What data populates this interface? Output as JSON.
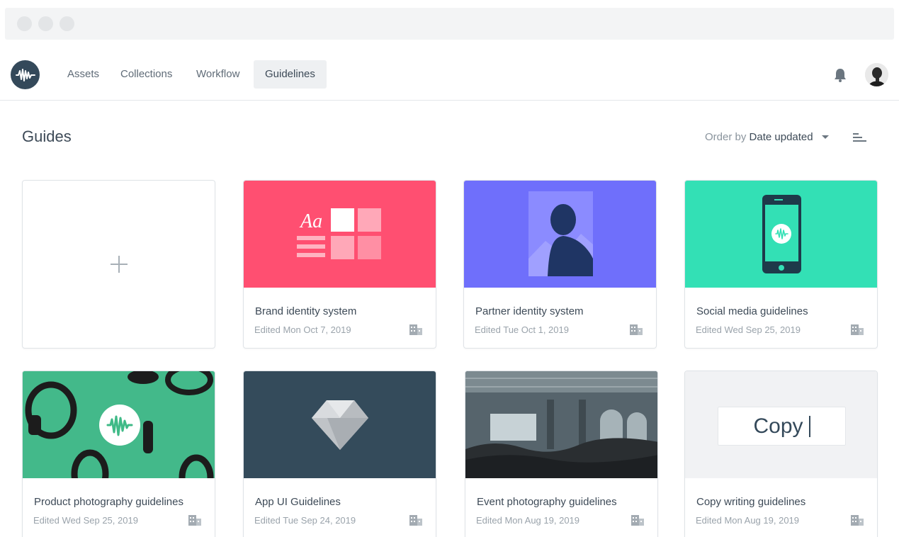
{
  "nav": {
    "items": [
      {
        "label": "Assets",
        "active": false
      },
      {
        "label": "Collections",
        "active": false
      },
      {
        "label": "Workflow",
        "active": false
      },
      {
        "label": "Guidelines",
        "active": true
      }
    ],
    "icons": {
      "logo": "waveform-logo-icon",
      "notifications": "bell-icon",
      "profile": "avatar"
    }
  },
  "page": {
    "title": "Guides",
    "order_prefix": "Order by",
    "order_value": "Date updated"
  },
  "cards": [
    {
      "title": "Brand identity system",
      "date": "Edited Mon Oct 7, 2019",
      "thumb_color": "#ff4f71"
    },
    {
      "title": "Partner identity system",
      "date": "Edited Tue Oct 1, 2019",
      "thumb_color": "#6f6ffb"
    },
    {
      "title": "Social media guidelines",
      "date": "Edited Wed Sep 25, 2019",
      "thumb_color": "#33e0b5"
    },
    {
      "title": "Product photography guidelines",
      "date": "Edited Wed Sep 25, 2019",
      "thumb_color": "#3fba87"
    },
    {
      "title": "App UI Guidelines",
      "date": "Edited Tue Sep 24, 2019",
      "thumb_color": "#344b5b"
    },
    {
      "title": "Event photography guidelines",
      "date": "Edited Mon Aug 19, 2019",
      "thumb_color": "#5c6a72"
    },
    {
      "title": "Copy writing guidelines",
      "date": "Edited Mon Aug 19, 2019",
      "thumb_color": "#f1f2f4",
      "thumb_text": "Copy"
    }
  ],
  "colors": {
    "accent": "#34495a",
    "text": "#3d4a57",
    "muted": "#9aa3ab"
  }
}
